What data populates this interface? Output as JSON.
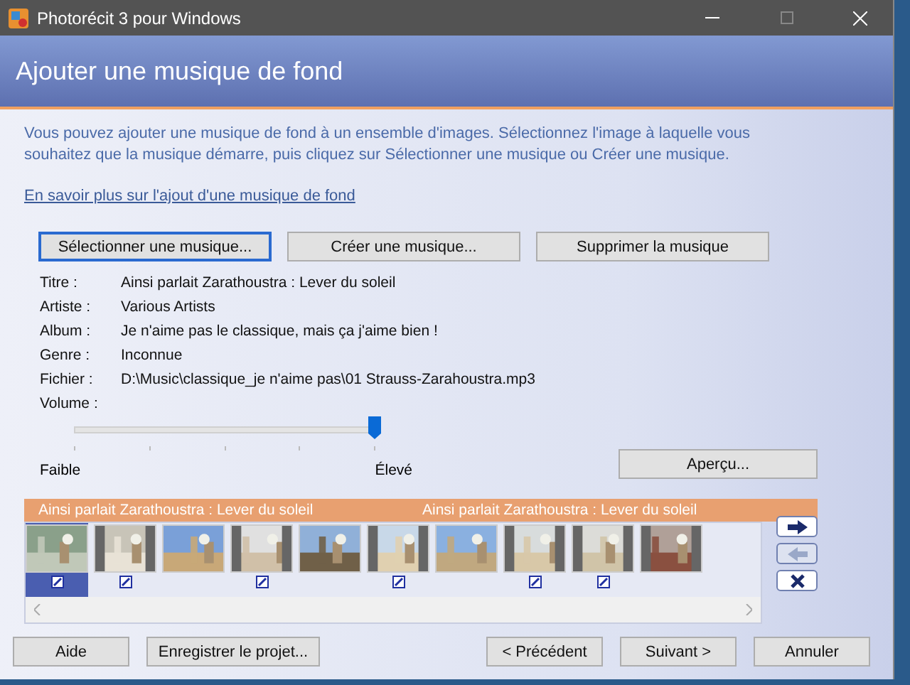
{
  "window": {
    "title": "Photorécit 3 pour Windows"
  },
  "header": {
    "title": "Ajouter une musique de fond"
  },
  "intro": "Vous pouvez ajouter une musique de fond à un ensemble d'images. Sélectionnez l'image à laquelle vous souhaitez que la musique démarre, puis cliquez sur Sélectionner une musique ou Créer une musique.",
  "learn_more_link": "En savoir plus sur l'ajout d'une musique de fond",
  "music_buttons": [
    {
      "label": "Sélectionner une musique...",
      "focused": true
    },
    {
      "label": "Créer une musique...",
      "focused": false
    },
    {
      "label": "Supprimer la musique",
      "focused": false
    }
  ],
  "details": [
    {
      "label": "Titre :",
      "value": "Ainsi parlait Zarathoustra : Lever du soleil"
    },
    {
      "label": "Artiste :",
      "value": "Various Artists"
    },
    {
      "label": "Album :",
      "value": "Je n'aime pas le classique, mais ça j'aime bien !"
    },
    {
      "label": "Genre :",
      "value": "Inconnue"
    },
    {
      "label": "Fichier :",
      "value": "D:\\Music\\classique_je n'aime pas\\01 Strauss-Zarahoustra.mp3"
    }
  ],
  "volume": {
    "label": "Volume :",
    "level": 1,
    "min_label": "Faible",
    "max_label": "Élevé"
  },
  "preview_button": "Aperçu...",
  "music_track": [
    "Ainsi parlait Zarathoustra : Lever du soleil",
    "Ainsi parlait Zarathoustra : Lever du soleil"
  ],
  "thumbnails": [
    {
      "selected": true,
      "edited": true
    },
    {
      "selected": false,
      "edited": true
    },
    {
      "selected": false,
      "edited": false
    },
    {
      "selected": false,
      "edited": true
    },
    {
      "selected": false,
      "edited": false
    },
    {
      "selected": false,
      "edited": true
    },
    {
      "selected": false,
      "edited": false
    },
    {
      "selected": false,
      "edited": true
    },
    {
      "selected": false,
      "edited": true
    },
    {
      "selected": false,
      "edited": false
    }
  ],
  "side_buttons": [
    {
      "kind": "right",
      "disabled": false
    },
    {
      "kind": "left",
      "disabled": true
    },
    {
      "kind": "delete",
      "disabled": false
    }
  ],
  "footer_buttons": [
    "Aide",
    "Enregistrer le projet...",
    "< Précédent",
    "Suivant >",
    "Annuler"
  ]
}
